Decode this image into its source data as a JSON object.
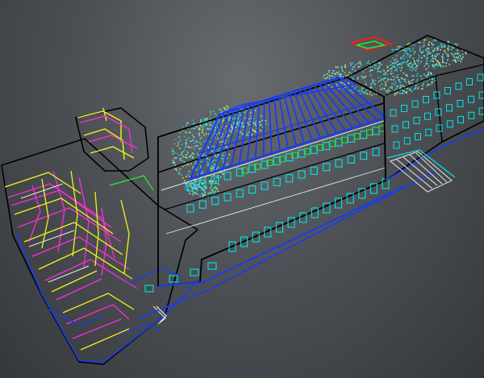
{
  "viewport": {
    "background_top": "#686c70",
    "background_bottom": "#35383b"
  },
  "colors": {
    "frame": "#000000",
    "roof_structure": "#1a3cf0",
    "floor_slab": "#1a3cf0",
    "windows": "#00e5e5",
    "partition_magenta": "#ff2bd6",
    "partition_yellow": "#f2f21a",
    "partition_green": "#22ee33",
    "partition_white": "#e8e8e8",
    "roof_marker": "#ff1a1a",
    "point_cloud_cool": "#10c8d8",
    "point_cloud_warm": "#d8e040"
  },
  "icons": {
    "roof_marker": "roof-marker-icon",
    "stair": "stair-icon"
  }
}
